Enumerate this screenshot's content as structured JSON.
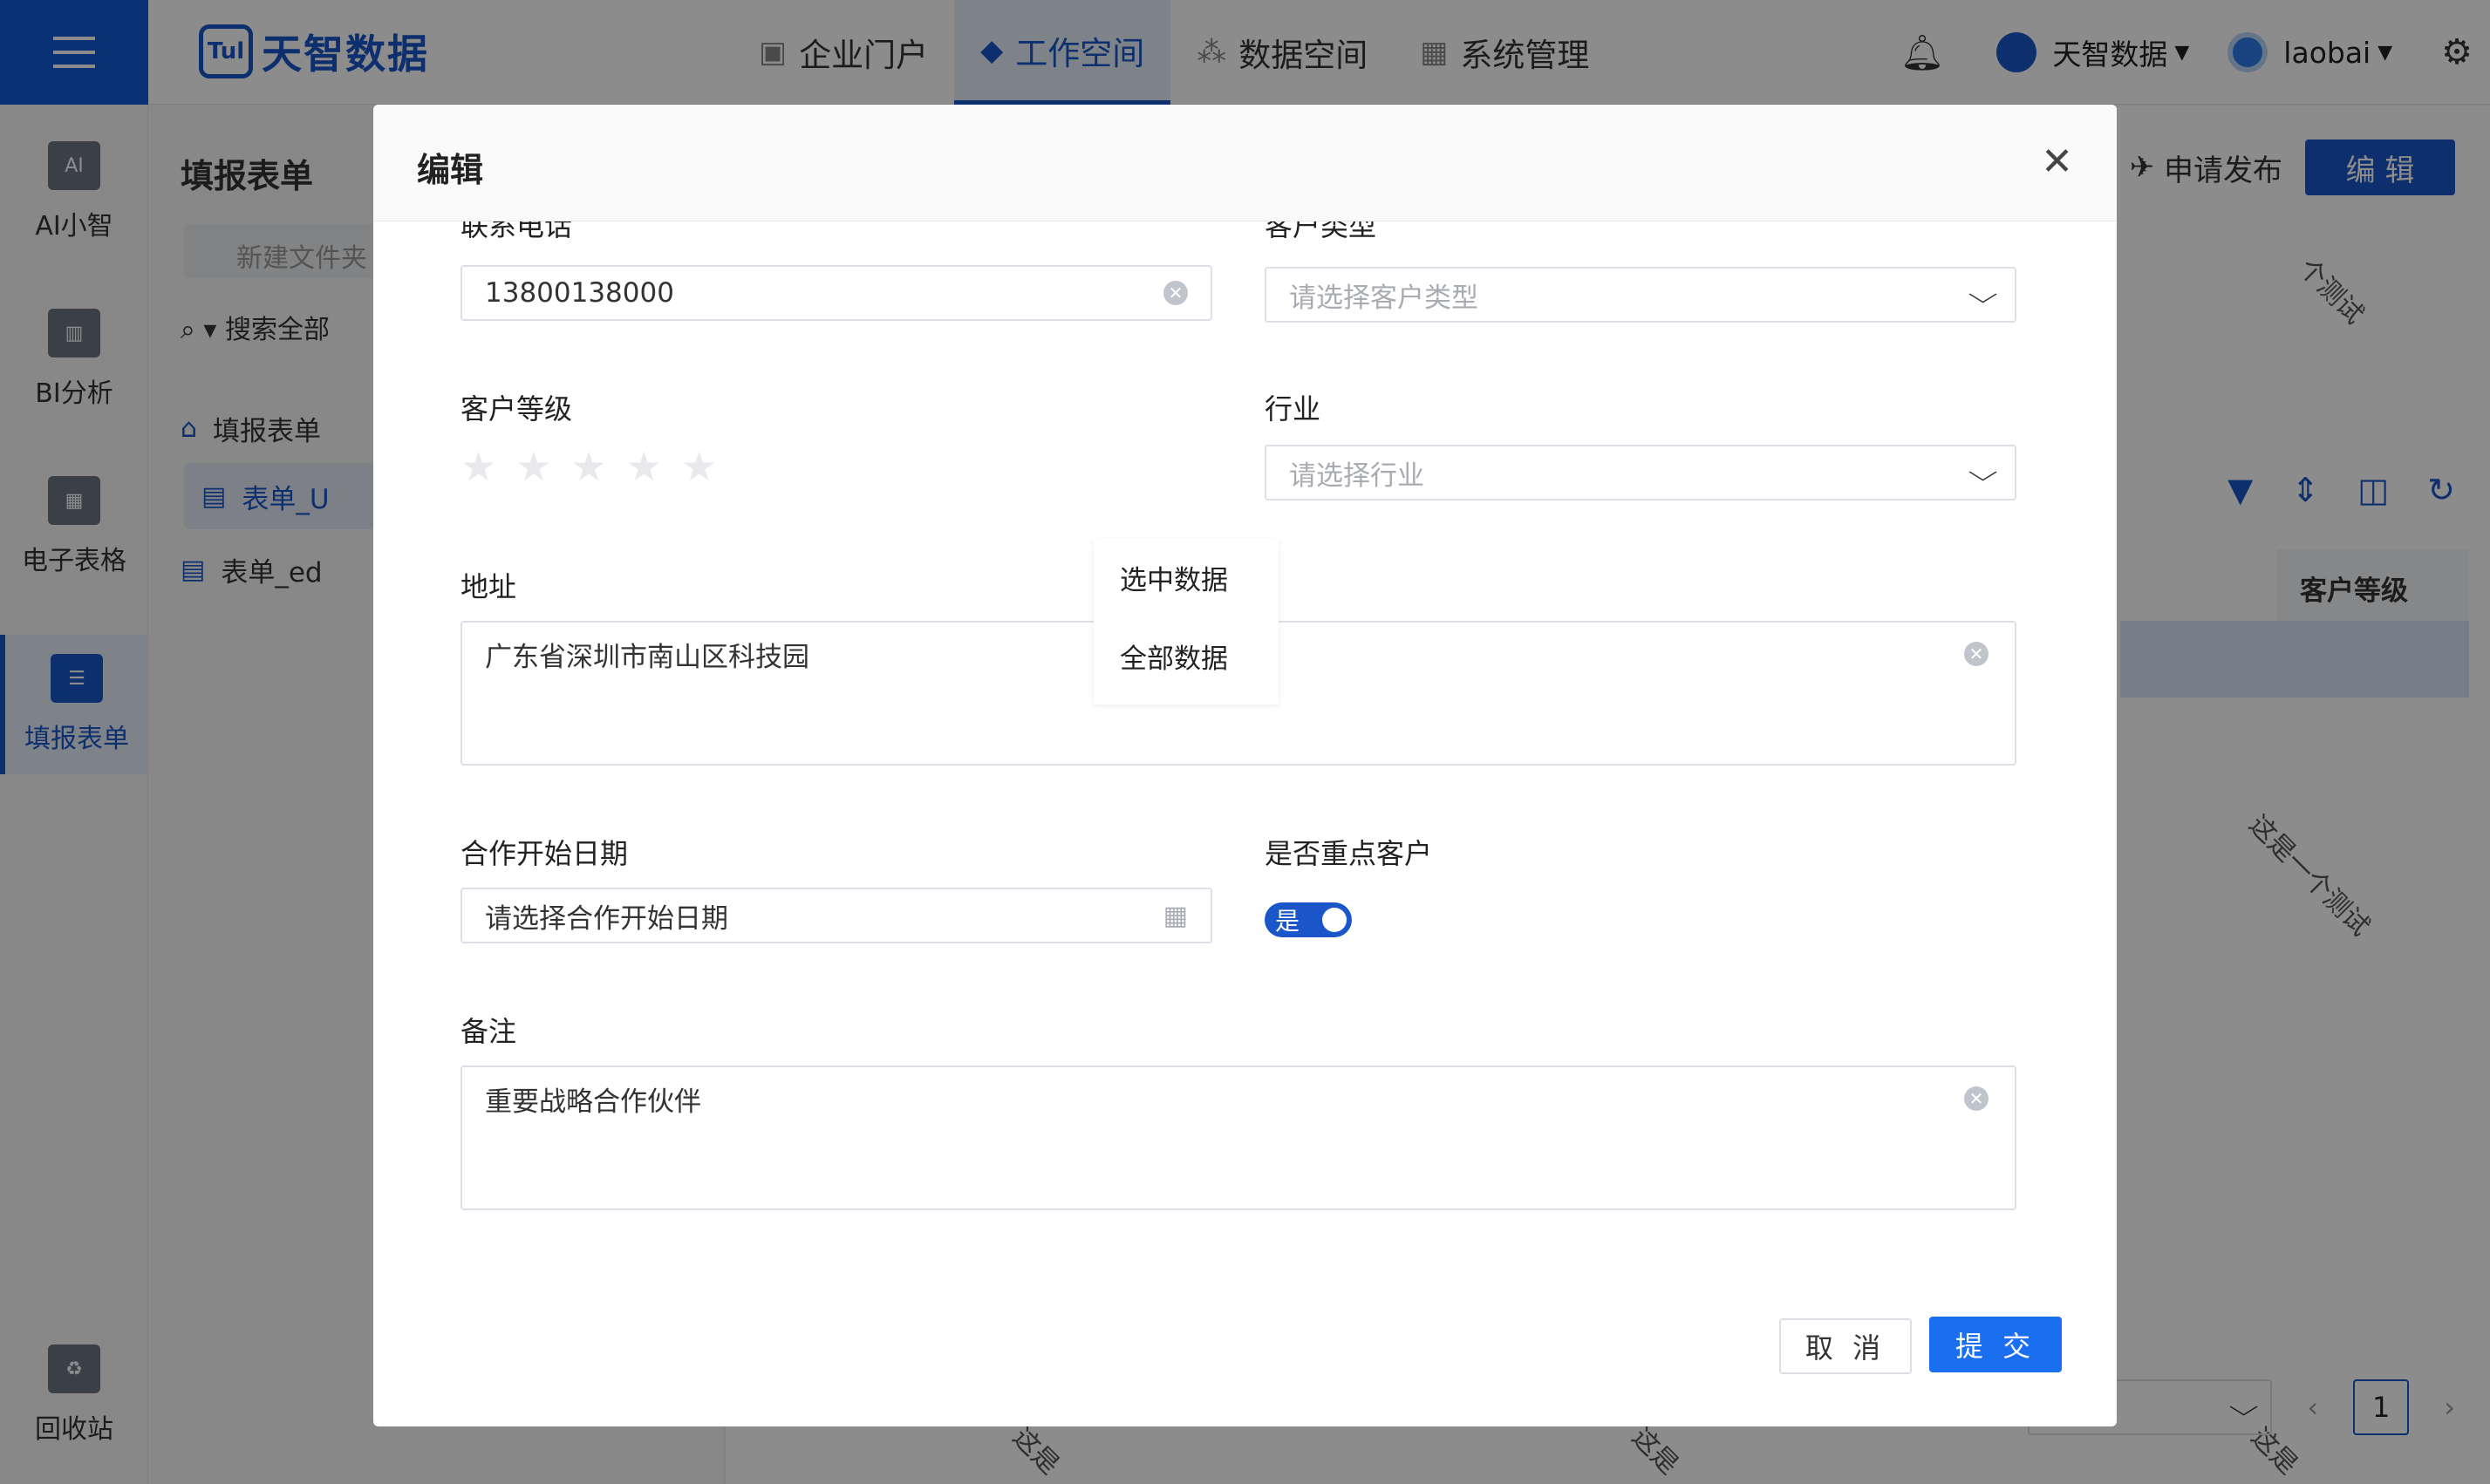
{
  "app": {
    "logo_mark": "Tul",
    "logo_text": "天智数据",
    "nav": [
      "企业门户",
      "工作空间",
      "数据空间",
      "系统管理"
    ],
    "workspace": "天智数据",
    "user": "laobai"
  },
  "sidebar": {
    "items": [
      "AI小智",
      "BI分析",
      "电子表格",
      "填报表单",
      "回收站"
    ],
    "ai_icon_text": "AI"
  },
  "panel": {
    "title": "填报表单",
    "new_folder": "新建文件夹",
    "search": "搜索全部",
    "tree": [
      "填报表单",
      "表单_U",
      "表单_ed"
    ]
  },
  "main": {
    "publish": "申请发布",
    "edit": "编 辑",
    "column_header": "客户等级",
    "watermarks": [
      "个测试",
      "这是一个测试",
      "这是",
      "这是",
      "这是"
    ],
    "page": "1"
  },
  "modal": {
    "title": "编辑",
    "fields": {
      "phone": {
        "label": "联系电话",
        "value": "13800138000"
      },
      "customer_type": {
        "label": "客户类型",
        "placeholder": "请选择客户类型"
      },
      "customer_level": {
        "label": "客户等级",
        "rating": 0,
        "max": 5
      },
      "industry": {
        "label": "行业",
        "placeholder": "请选择行业"
      },
      "address": {
        "label": "地址",
        "value": "广东省深圳市南山区科技园"
      },
      "start_date": {
        "label": "合作开始日期",
        "placeholder": "请选择合作开始日期"
      },
      "key_customer": {
        "label": "是否重点客户",
        "value": "是",
        "on": true
      },
      "remark": {
        "label": "备注",
        "value": "重要战略合作伙伴"
      }
    },
    "dropdown": [
      "选中数据",
      "全部数据"
    ],
    "cancel": "取 消",
    "submit": "提 交"
  },
  "colors": {
    "primary": "#1a56c9",
    "submit": "#1a6ef0",
    "overlay": "rgba(0,0,0,0.45)"
  }
}
